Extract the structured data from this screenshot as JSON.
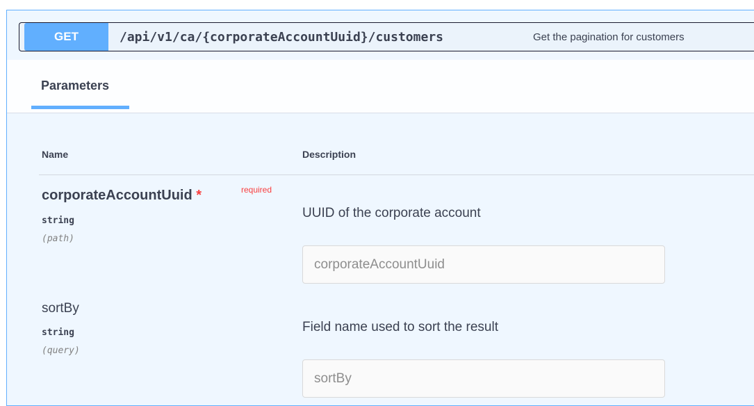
{
  "operation": {
    "method": "GET",
    "path": "/api/v1/ca/{corporateAccountUuid}/customers",
    "summary": "Get the pagination for customers"
  },
  "tabs": {
    "parameters": "Parameters"
  },
  "columns": {
    "name": "Name",
    "description": "Description"
  },
  "parameters": [
    {
      "name": "corporateAccountUuid",
      "required_mark": "*",
      "required_label": "required",
      "type": "string",
      "in": "(path)",
      "description": "UUID of the corporate account",
      "placeholder": "corporateAccountUuid"
    },
    {
      "name": "sortBy",
      "type": "string",
      "in": "(query)",
      "description": "Field name used to sort the result",
      "placeholder": "sortBy"
    }
  ],
  "colors": {
    "method_get": "#61affe",
    "required": "#f93e3e"
  }
}
